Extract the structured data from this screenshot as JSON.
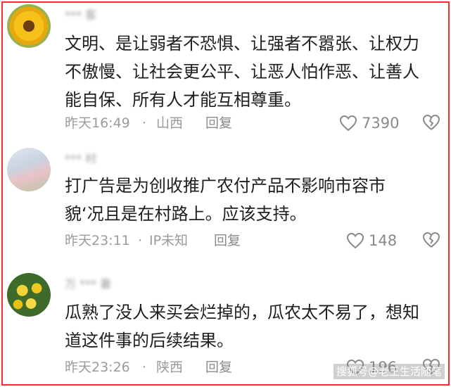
{
  "comments": [
    {
      "username": "*** 客",
      "lines": [
        "文明、是让弱者不恐惧、让强者不嚣张、让权力",
        "不傲慢、让社会更公平、让恶人怕作恶、让善人",
        "能自保、所有人才能互相尊重。"
      ],
      "time": "昨天16:49",
      "separator": "·",
      "location": "山西",
      "reply_label": "回复",
      "likes": "7390",
      "like_icon": "heart-outline-icon",
      "dislike_icon": "broken-heart-icon"
    },
    {
      "username": "*** 村",
      "lines": [
        "打广告是为创收推广农付产品不影响市容市",
        "貌‘况且是在村路上。应该支持。"
      ],
      "time": "昨天23:11",
      "separator": "·",
      "location": "IP未知",
      "reply_label": "回复",
      "likes": "148",
      "like_icon": "heart-outline-icon",
      "dislike_icon": "broken-heart-icon"
    },
    {
      "username": "万 *** 暑",
      "lines": [
        "瓜熟了没人来买会烂掉的，瓜农太不易了，想知",
        "道这件事的后续结果。"
      ],
      "time": "昨天23:26",
      "separator": "·",
      "location": "陕西",
      "reply_label": "回复",
      "likes": "196",
      "like_icon": "heart-outline-icon",
      "dislike_icon": "broken-heart-icon"
    }
  ],
  "watermark": "搜狐号@老王生活随笔",
  "colors": {
    "border": "#ff2a2a",
    "text": "#1e1e1e",
    "meta": "#9b9b9b"
  }
}
